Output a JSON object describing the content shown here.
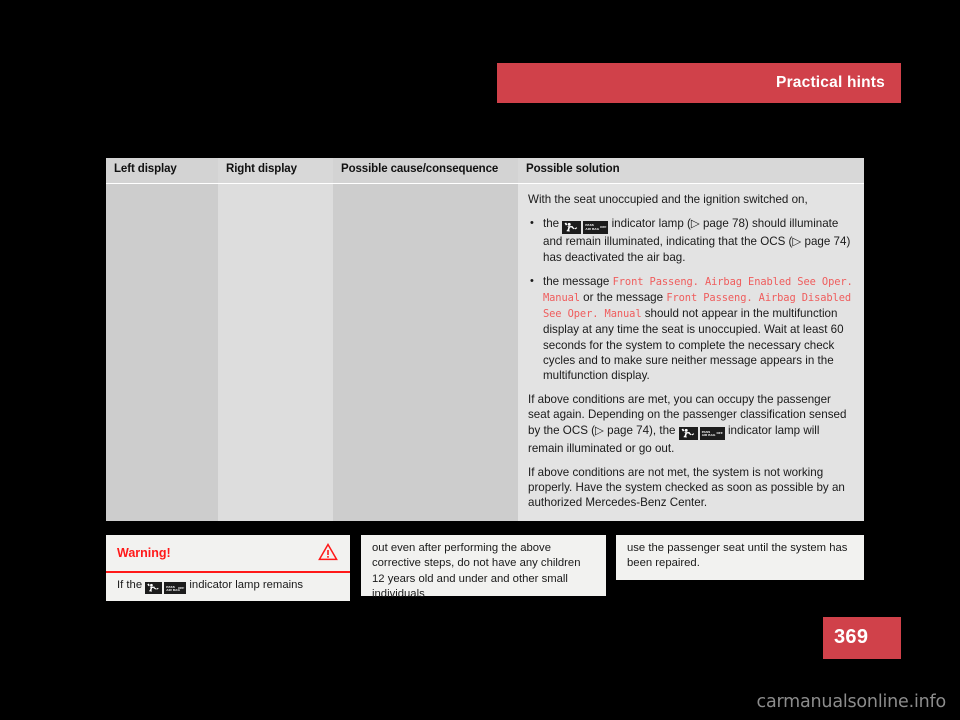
{
  "header": {
    "title": "Practical hints",
    "banner_color": "#d0414a"
  },
  "table": {
    "columns": [
      {
        "header": "Left display"
      },
      {
        "header": "Right display"
      },
      {
        "header": "Possible cause/consequence"
      },
      {
        "header": "Possible solution"
      }
    ],
    "solution": {
      "intro": "With the seat unoccupied and the ignition switched on,",
      "bullets": [
        {
          "pre": "the",
          "icon_name": "pass-air-bag-off-indicator-icon",
          "post": "indicator lamp (▷ page 78) should illuminate and remain illuminated, indicating that the OCS (▷ page 74) has deactivated the air bag."
        },
        {
          "pre": "the message",
          "message_1": "Front Passeng. Airbag Enabled See Oper. Manual",
          "mid": "or the message",
          "message_2": "Front Passeng. Airbag Disabled See Oper. Manual",
          "post": "should not appear in the multifunction display at any time the seat is unoccupied. Wait at least 60 seconds for the system to complete the necessary check cycles and to make sure neither message appears in the multifunction display."
        }
      ],
      "paragraph_2_pre": "If above conditions are met, you can occupy the passenger seat again. Depending on the passenger classification sensed by the OCS (▷ page 74), the",
      "paragraph_2_post": "indicator lamp will remain illuminated or go out.",
      "paragraph_3": "If above conditions are not met, the system is not working properly. Have the system checked as soon as possible by an authorized Mercedes-Benz Center."
    }
  },
  "warning_box": {
    "title": "Warning!",
    "icon_name": "warning-triangle-icon",
    "text_pre": "If the",
    "text_post": "indicator lamp remains",
    "accent_color": "#ff1919"
  },
  "mid_box": {
    "text": "out even after performing the above corrective steps, do not have any children 12 years old and under and other small individuals"
  },
  "right_box": {
    "text": "use the passenger seat until the system has been repaired."
  },
  "footer": {
    "page_number": "369",
    "watermark": "carmanualsonline.info"
  },
  "lamp_icon": {
    "text_line_1": "PASS",
    "text_line_2": "AIR BAG",
    "text_off": "OFF"
  }
}
